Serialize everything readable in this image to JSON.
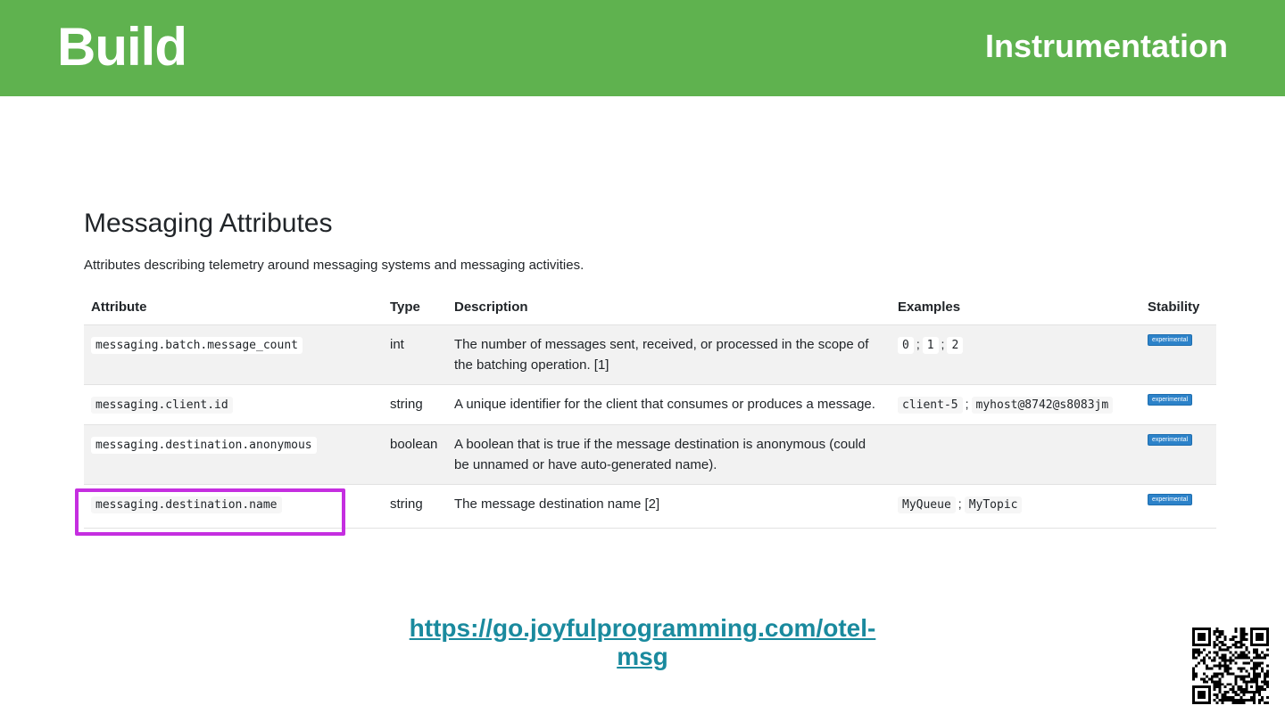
{
  "banner": {
    "title": "Build",
    "section": "Instrumentation",
    "color": "#5fb24f"
  },
  "doc": {
    "heading": "Messaging Attributes",
    "intro": "Attributes describing telemetry around messaging systems and messaging activities.",
    "columns": [
      "Attribute",
      "Type",
      "Description",
      "Examples",
      "Stability"
    ],
    "rows": [
      {
        "attribute": "messaging.batch.message_count",
        "type": "int",
        "description": "The number of messages sent, received, or processed in the scope of the batching operation. [1]",
        "examples": [
          "0",
          "1",
          "2"
        ],
        "stability": "experimental"
      },
      {
        "attribute": "messaging.client.id",
        "type": "string",
        "description": "A unique identifier for the client that consumes or produces a message.",
        "examples": [
          "client-5",
          "myhost@8742@s8083jm"
        ],
        "stability": "experimental"
      },
      {
        "attribute": "messaging.destination.anonymous",
        "type": "boolean",
        "description": "A boolean that is true if the message destination is anonymous (could be unnamed or have auto-generated name).",
        "examples": [],
        "stability": "experimental"
      },
      {
        "attribute": "messaging.destination.name",
        "type": "string",
        "description": "The message destination name [2]",
        "examples": [
          "MyQueue",
          "MyTopic"
        ],
        "stability": "experimental"
      }
    ],
    "separator": ";"
  },
  "highlight": {
    "color": "#c52ee0"
  },
  "link": {
    "text": "https://go.joyfulprogramming.com/otel-msg",
    "color": "#1a8a9e"
  },
  "qr": {
    "icon": "qr-code-icon"
  }
}
